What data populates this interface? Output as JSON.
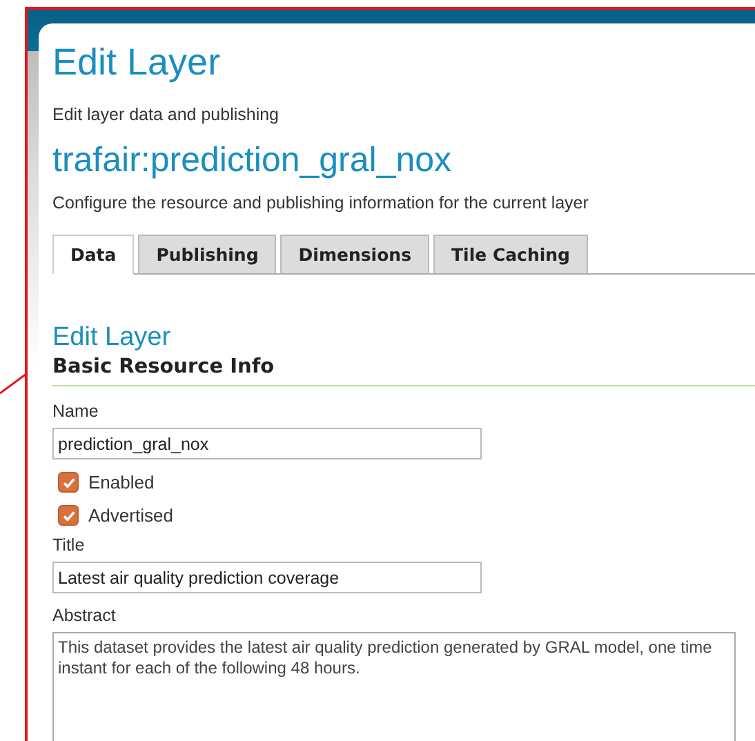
{
  "page": {
    "title": "Edit Layer",
    "subtitle": "Edit layer data and publishing",
    "layer_name": "trafair:prediction_gral_nox",
    "description": "Configure the resource and publishing information for the current layer"
  },
  "tabs": [
    {
      "label": "Data",
      "selected": true
    },
    {
      "label": "Publishing",
      "selected": false
    },
    {
      "label": "Dimensions",
      "selected": false
    },
    {
      "label": "Tile Caching",
      "selected": false
    }
  ],
  "section": {
    "title": "Edit Layer",
    "heading": "Basic Resource Info"
  },
  "fields": [
    {
      "kind": "text",
      "label": "Name",
      "value": "prediction_gral_nox"
    },
    {
      "kind": "checkbox",
      "label": "Enabled",
      "checked": true
    },
    {
      "kind": "checkbox",
      "label": "Advertised",
      "checked": true
    },
    {
      "kind": "text",
      "label": "Title",
      "value": "Latest air quality prediction coverage"
    },
    {
      "kind": "textarea",
      "label": "Abstract",
      "value": "This dataset provides the latest air quality prediction generated by GRAL model, one time instant for each of the following 48 hours."
    }
  ]
}
